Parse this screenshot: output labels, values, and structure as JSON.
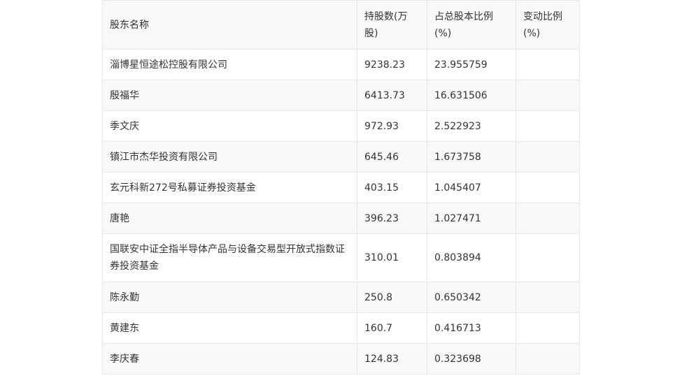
{
  "table": {
    "headers": [
      "股东名称",
      "持股数(万股)",
      "占总股本比例(%)",
      "变动比例(%)"
    ],
    "rows": [
      [
        "淄博星恒途松控股有限公司",
        "9238.23",
        "23.955759",
        ""
      ],
      [
        "殷福华",
        "6413.73",
        "16.631506",
        ""
      ],
      [
        "季文庆",
        "972.93",
        "2.522923",
        ""
      ],
      [
        "镇江市杰华投资有限公司",
        "645.46",
        "1.673758",
        ""
      ],
      [
        "玄元科新272号私募证券投资基金",
        "403.15",
        "1.045407",
        ""
      ],
      [
        "唐艳",
        "396.23",
        "1.027471",
        ""
      ],
      [
        "国联安中证全指半导体产品与设备交易型开放式指数证券投资基金",
        "310.01",
        "0.803894",
        ""
      ],
      [
        "陈永勤",
        "250.8",
        "0.650342",
        ""
      ],
      [
        "黄建东",
        "160.7",
        "0.416713",
        ""
      ],
      [
        "李庆春",
        "124.83",
        "0.323698",
        ""
      ]
    ]
  }
}
